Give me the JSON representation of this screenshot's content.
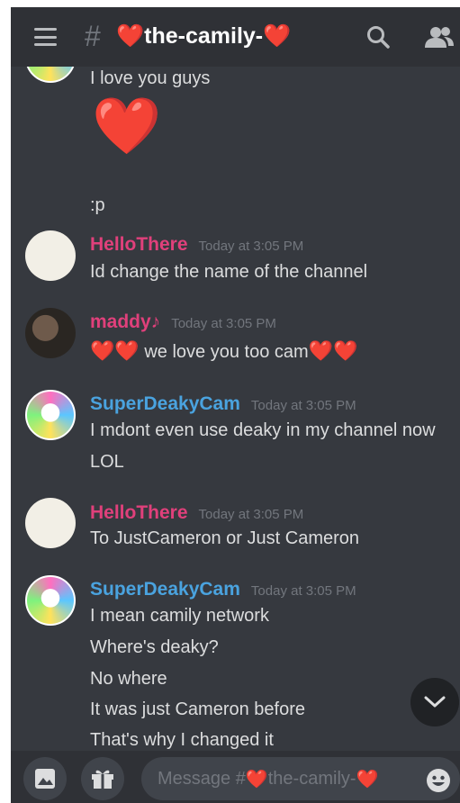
{
  "header": {
    "hash": "#",
    "channel_heart": "❤️",
    "channel_name": "the-camily-",
    "icons": [
      "hamburger-icon",
      "search-icon",
      "members-icon"
    ]
  },
  "messages": [
    {
      "avatar": "partial-avatar",
      "lines": [
        "I love you guys",
        ":p"
      ],
      "big_heart": "❤️"
    },
    {
      "username": "HelloThere",
      "username_color": "#e0407b",
      "timestamp": "Today at 3:05 PM",
      "lines": [
        "Id change the name of the channel"
      ]
    },
    {
      "username": "maddy♪",
      "username_color": "#e0407b",
      "timestamp": "Today at 3:05 PM",
      "line_prefix_hearts": "❤️❤️",
      "line_text": " we love you too cam",
      "line_suffix_hearts": "❤️❤️"
    },
    {
      "username": "SuperDeakyCam",
      "username_color": "#4aa3df",
      "timestamp": "Today at 3:05 PM",
      "lines": [
        "I mdont even use deaky in my channel now",
        "LOL"
      ]
    },
    {
      "username": "HelloThere",
      "username_color": "#e0407b",
      "timestamp": "Today at 3:05 PM",
      "lines": [
        "To JustCameron or Just Cameron"
      ]
    },
    {
      "username": "SuperDeakyCam",
      "username_color": "#4aa3df",
      "timestamp": "Today at 3:05 PM",
      "lines": [
        "I mean camily network",
        "Where's deaky?",
        "No where",
        "It was just Cameron before",
        "That's why I changed it"
      ]
    }
  ],
  "composer": {
    "placeholder_prefix": "Message #",
    "placeholder_heart": "❤️",
    "placeholder_channel": "the-camily-",
    "placeholder_suffix_heart": "❤️",
    "icons": [
      "image-icon",
      "gift-icon",
      "emoji-icon"
    ]
  },
  "colors": {
    "background": "#36393f",
    "header": "#2f3136",
    "pink_user": "#e0407b",
    "blue_user": "#4aa3df",
    "heart": "#e1251b"
  }
}
